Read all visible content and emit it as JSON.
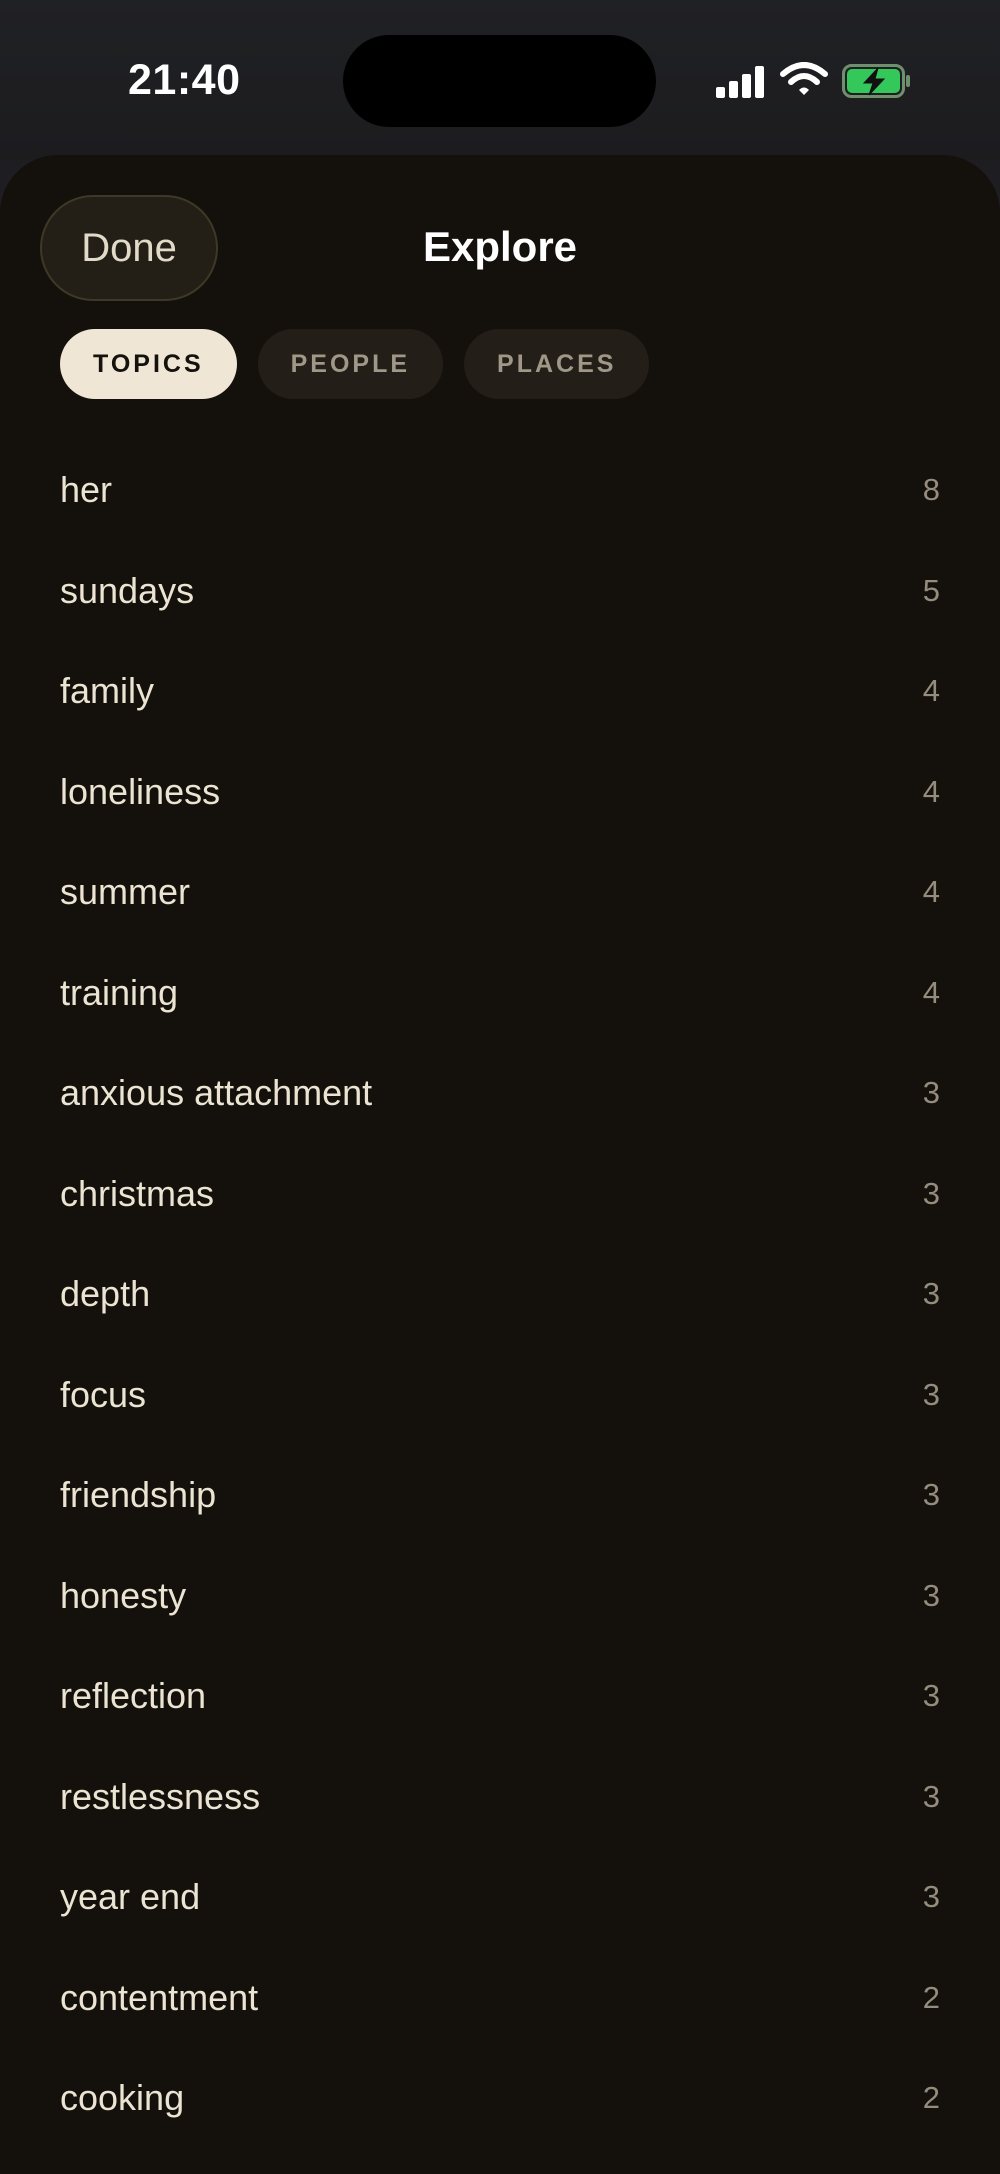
{
  "status_bar": {
    "time": "21:40",
    "icons": [
      "cellular-signal-icon",
      "wifi-icon",
      "battery-charging-icon"
    ],
    "battery_color": "#34c759"
  },
  "header": {
    "done_label": "Done",
    "title": "Explore"
  },
  "tabs": [
    {
      "label": "TOPICS",
      "active": true
    },
    {
      "label": "PEOPLE",
      "active": false
    },
    {
      "label": "PLACES",
      "active": false
    }
  ],
  "topics": [
    {
      "label": "her",
      "count": "8"
    },
    {
      "label": "sundays",
      "count": "5"
    },
    {
      "label": "family",
      "count": "4"
    },
    {
      "label": "loneliness",
      "count": "4"
    },
    {
      "label": "summer",
      "count": "4"
    },
    {
      "label": "training",
      "count": "4"
    },
    {
      "label": "anxious attachment",
      "count": "3"
    },
    {
      "label": "christmas",
      "count": "3"
    },
    {
      "label": "depth",
      "count": "3"
    },
    {
      "label": "focus",
      "count": "3"
    },
    {
      "label": "friendship",
      "count": "3"
    },
    {
      "label": "honesty",
      "count": "3"
    },
    {
      "label": "reflection",
      "count": "3"
    },
    {
      "label": "restlessness",
      "count": "3"
    },
    {
      "label": "year end",
      "count": "3"
    },
    {
      "label": "contentment",
      "count": "2"
    },
    {
      "label": "cooking",
      "count": "2"
    }
  ],
  "colors": {
    "sheet_background": "#14100b",
    "active_tab": "#efe6d5",
    "inactive_tab": "#231e17"
  }
}
